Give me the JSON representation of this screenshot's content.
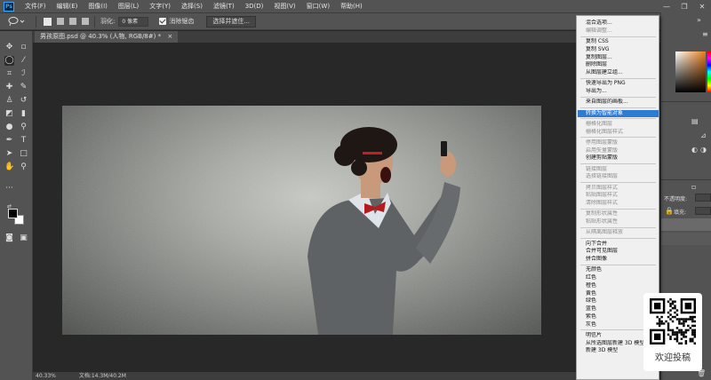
{
  "app": {
    "logo": "Ps"
  },
  "menubar": {
    "items": [
      "文件(F)",
      "编辑(E)",
      "图像(I)",
      "图层(L)",
      "文字(Y)",
      "选择(S)",
      "滤镜(T)",
      "3D(D)",
      "视图(V)",
      "窗口(W)",
      "帮助(H)"
    ]
  },
  "window_controls": {
    "minimize": "—",
    "restore": "❐",
    "close": "✕"
  },
  "options": {
    "feather_label": "羽化:",
    "feather_value": "0 像素",
    "antialias_label": "消除锯齿",
    "select_mask_button": "选择并遮住..."
  },
  "document": {
    "tab_title": "男孩原图.psd @ 40.3% (人物, RGB/8#) *",
    "tab_close": "×",
    "zoom": "40.33%",
    "doc_size": "文档:14.3M/40.2M"
  },
  "right_panel": {
    "opacity_label": "不透明度:",
    "fill_label": "填充:"
  },
  "context_menu": {
    "highlight_color": "#2e7bd6",
    "groups": [
      [
        {
          "label": "混合选项...",
          "enabled": true
        },
        {
          "label": "编辑调整...",
          "enabled": false
        }
      ],
      [
        {
          "label": "复制 CSS",
          "enabled": true
        },
        {
          "label": "复制 SVG",
          "enabled": true
        },
        {
          "label": "复制图层...",
          "enabled": true
        },
        {
          "label": "删除图层",
          "enabled": true
        },
        {
          "label": "从图层建立组...",
          "enabled": true
        }
      ],
      [
        {
          "label": "快速导出为 PNG",
          "enabled": true
        },
        {
          "label": "导出为...",
          "enabled": true
        }
      ],
      [
        {
          "label": "来自图层的画板...",
          "enabled": true
        }
      ],
      [
        {
          "label": "转换为智能对象",
          "enabled": true,
          "highlighted": true
        }
      ],
      [
        {
          "label": "栅格化图层",
          "enabled": false
        },
        {
          "label": "栅格化图层样式",
          "enabled": false
        }
      ],
      [
        {
          "label": "停用图层蒙版",
          "enabled": false
        },
        {
          "label": "启用矢量蒙版",
          "enabled": false
        },
        {
          "label": "创建剪贴蒙版",
          "enabled": true
        }
      ],
      [
        {
          "label": "链接图层",
          "enabled": false
        },
        {
          "label": "选择链接图层",
          "enabled": false
        }
      ],
      [
        {
          "label": "拷贝图层样式",
          "enabled": false
        },
        {
          "label": "粘贴图层样式",
          "enabled": false
        },
        {
          "label": "清除图层样式",
          "enabled": false
        }
      ],
      [
        {
          "label": "复制形状属性",
          "enabled": false
        },
        {
          "label": "粘贴形状属性",
          "enabled": false
        }
      ],
      [
        {
          "label": "从隔离图层释放",
          "enabled": false
        }
      ],
      [
        {
          "label": "向下合并",
          "enabled": true
        },
        {
          "label": "合并可见图层",
          "enabled": true
        },
        {
          "label": "拼合图像",
          "enabled": true
        }
      ],
      [
        {
          "label": "无颜色",
          "enabled": true
        },
        {
          "label": "红色",
          "enabled": true
        },
        {
          "label": "橙色",
          "enabled": true
        },
        {
          "label": "黄色",
          "enabled": true
        },
        {
          "label": "绿色",
          "enabled": true
        },
        {
          "label": "蓝色",
          "enabled": true
        },
        {
          "label": "紫色",
          "enabled": true
        },
        {
          "label": "灰色",
          "enabled": true
        }
      ],
      [
        {
          "label": "明信片",
          "enabled": true
        },
        {
          "label": "从所选图层新建 3D 模型",
          "enabled": true
        },
        {
          "label": "新建 3D 模型",
          "enabled": true
        }
      ]
    ]
  },
  "watermark": {
    "text": "欢迎投稿"
  }
}
